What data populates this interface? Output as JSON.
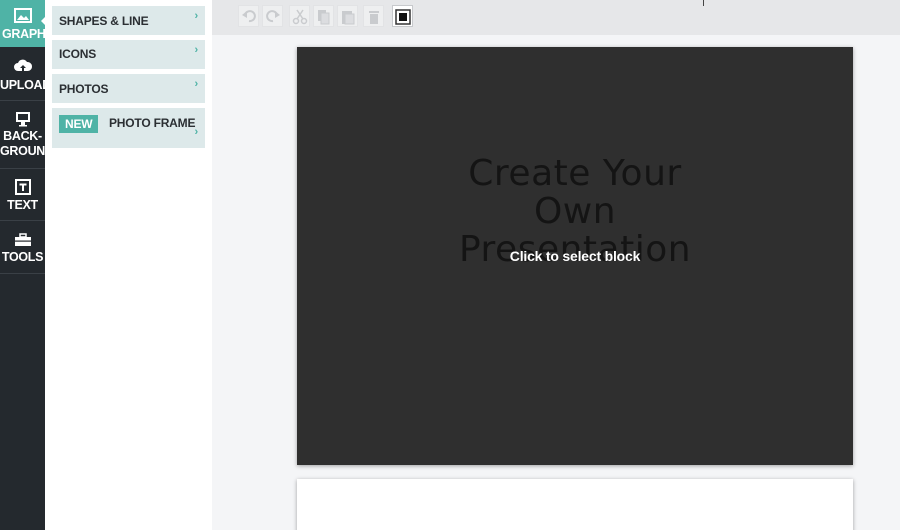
{
  "sidebar": {
    "items": [
      {
        "label": "GRAPHICS",
        "icon": "image-icon",
        "active": true
      },
      {
        "label": "UPLOAD",
        "icon": "cloud-upload-icon"
      },
      {
        "label_line1": "BACK-",
        "label_line2": "GROUND",
        "icon": "monitor-icon"
      },
      {
        "label": "TEXT",
        "icon": "text-box-icon"
      },
      {
        "label": "TOOLS",
        "icon": "toolbox-icon"
      }
    ]
  },
  "menu": {
    "items": [
      {
        "label": "SHAPES & LINE"
      },
      {
        "label": "ICONS"
      },
      {
        "label": "PHOTOS"
      },
      {
        "badge": "NEW",
        "label": "PHOTO FRAME"
      }
    ],
    "chevron": "›"
  },
  "toolbar": {
    "buttons": [
      "undo-icon",
      "redo-icon",
      "cut-icon",
      "copy-icon",
      "paste-icon",
      "delete-icon",
      "layer-icon"
    ]
  },
  "slide": {
    "heading_line1": "Create Your",
    "heading_line2": "Own",
    "heading_line3": "Presentation",
    "overlay": "Click to select block"
  },
  "colors": {
    "accent": "#4fb3a6",
    "sidebar": "#24292e",
    "menu_item_bg": "#dde9ea",
    "slide_bg": "#2f2f2f"
  }
}
